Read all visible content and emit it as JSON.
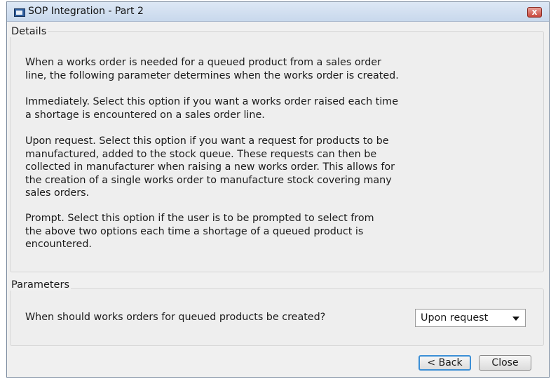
{
  "window": {
    "title": "SOP Integration - Part 2",
    "close_glyph": "x"
  },
  "details": {
    "label": "Details",
    "paragraphs": [
      "When a works order is needed for a queued product from a sales order\nline, the following parameter determines when the works order is created.",
      "Immediately. Select this option if you want a works order raised each time\na shortage is encountered on a sales order line.",
      "Upon request. Select this option if you want a request for products to be\nmanufactured, added to the stock queue. These requests can then be\ncollected in manufacturer when raising a new works order. This allows for\nthe creation of a single works order to manufacture stock covering many\nsales orders.",
      "Prompt. Select this option if the user is to be prompted to select from\nthe above two options each time a shortage of a queued product is\nencountered."
    ]
  },
  "parameters": {
    "label": "Parameters",
    "question": "When should works orders for queued products be created?",
    "selected_value": "Upon request"
  },
  "buttons": {
    "back": "< Back",
    "close": "Close"
  },
  "colors": {
    "accent": "#3c8fd6",
    "close_button": "#c8453a"
  }
}
